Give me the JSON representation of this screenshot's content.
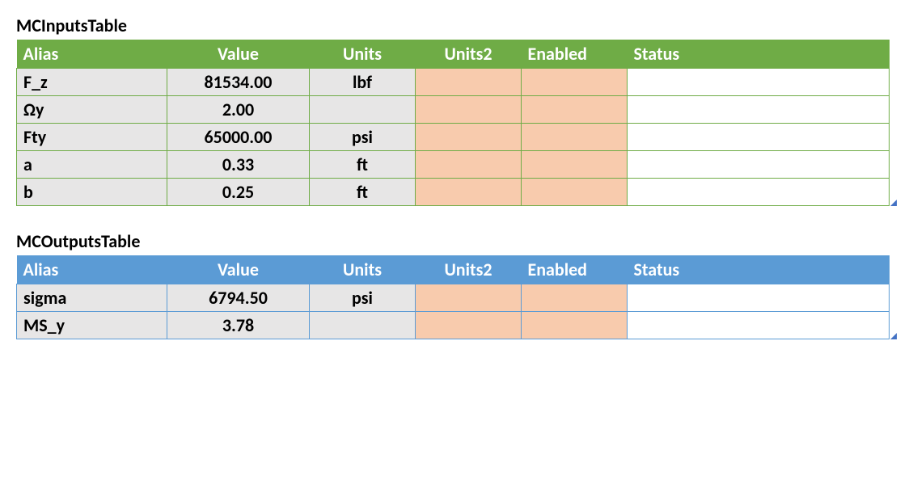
{
  "inputs": {
    "title": "MCInputsTable",
    "columns": {
      "alias": "Alias",
      "value": "Value",
      "units": "Units",
      "units2": "Units2",
      "enabled": "Enabled",
      "status": "Status"
    },
    "rows": [
      {
        "alias": "F_z",
        "value": "81534.00",
        "units": "lbf",
        "units2": "",
        "enabled": "",
        "status": ""
      },
      {
        "alias": "Ωy",
        "value": "2.00",
        "units": "",
        "units2": "",
        "enabled": "",
        "status": ""
      },
      {
        "alias": "Fty",
        "value": "65000.00",
        "units": "psi",
        "units2": "",
        "enabled": "",
        "status": ""
      },
      {
        "alias": "a",
        "value": "0.33",
        "units": "ft",
        "units2": "",
        "enabled": "",
        "status": ""
      },
      {
        "alias": "b",
        "value": "0.25",
        "units": "ft",
        "units2": "",
        "enabled": "",
        "status": ""
      }
    ]
  },
  "outputs": {
    "title": "MCOutputsTable",
    "columns": {
      "alias": "Alias",
      "value": "Value",
      "units": "Units",
      "units2": "Units2",
      "enabled": "Enabled",
      "status": "Status"
    },
    "rows": [
      {
        "alias": "sigma",
        "value": "6794.50",
        "units": "psi",
        "units2": "",
        "enabled": "",
        "status": ""
      },
      {
        "alias": "MS_y",
        "value": "3.78",
        "units": "",
        "units2": "",
        "enabled": "",
        "status": ""
      }
    ]
  }
}
